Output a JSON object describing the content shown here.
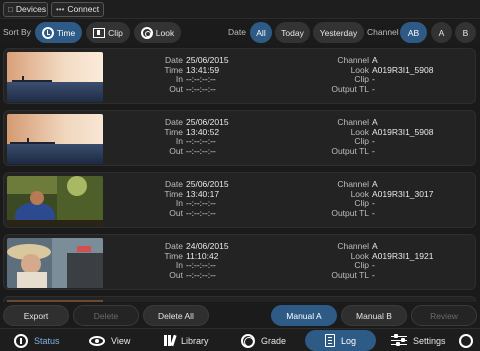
{
  "topbar": {
    "devices_label": "Devices",
    "connect_label": "Connect"
  },
  "filters": {
    "sort_by_label": "Sort By",
    "sort_options": [
      "Time",
      "Clip",
      "Look"
    ],
    "sort_active": "Time",
    "date_label": "Date",
    "date_options": [
      "All",
      "Today",
      "Yesterday"
    ],
    "date_active": "All",
    "channel_label": "Channel",
    "channel_options": [
      "AB",
      "A",
      "B"
    ],
    "channel_active": "AB"
  },
  "fields": {
    "date": "Date",
    "time": "Time",
    "in": "In",
    "out": "Out",
    "channel": "Channel",
    "look": "Look",
    "clip": "Clip",
    "output_tl": "Output TL"
  },
  "entries": [
    {
      "date": "25/06/2015",
      "time": "13:41:59",
      "in": "--:--:--:--",
      "out": "--:--:--:--",
      "channel": "A",
      "look": "A019R3I1_5908",
      "clip": "-",
      "output_tl": "-",
      "thumb": "sunset-water"
    },
    {
      "date": "25/06/2015",
      "time": "13:40:52",
      "in": "--:--:--:--",
      "out": "--:--:--:--",
      "channel": "A",
      "look": "A019R3I1_5908",
      "clip": "-",
      "output_tl": "-",
      "thumb": "sunset-water"
    },
    {
      "date": "25/06/2015",
      "time": "13:40:17",
      "in": "--:--:--:--",
      "out": "--:--:--:--",
      "channel": "A",
      "look": "A019R3I1_3017",
      "clip": "-",
      "output_tl": "-",
      "thumb": "forest-person"
    },
    {
      "date": "24/06/2015",
      "time": "11:10:42",
      "in": "--:--:--:--",
      "out": "--:--:--:--",
      "channel": "A",
      "look": "A019R3I1_1921",
      "clip": "-",
      "output_tl": "-",
      "thumb": "woman-hat"
    }
  ],
  "actions": {
    "export": "Export",
    "delete": "Delete",
    "delete_all": "Delete All",
    "manual_a": "Manual A",
    "manual_b": "Manual B",
    "review": "Review"
  },
  "nav": {
    "status": "Status",
    "view": "View",
    "library": "Library",
    "grade": "Grade",
    "log": "Log",
    "settings": "Settings"
  },
  "colors": {
    "accent": "#2e5a86",
    "background": "#1a1a1a",
    "row": "#232323"
  }
}
